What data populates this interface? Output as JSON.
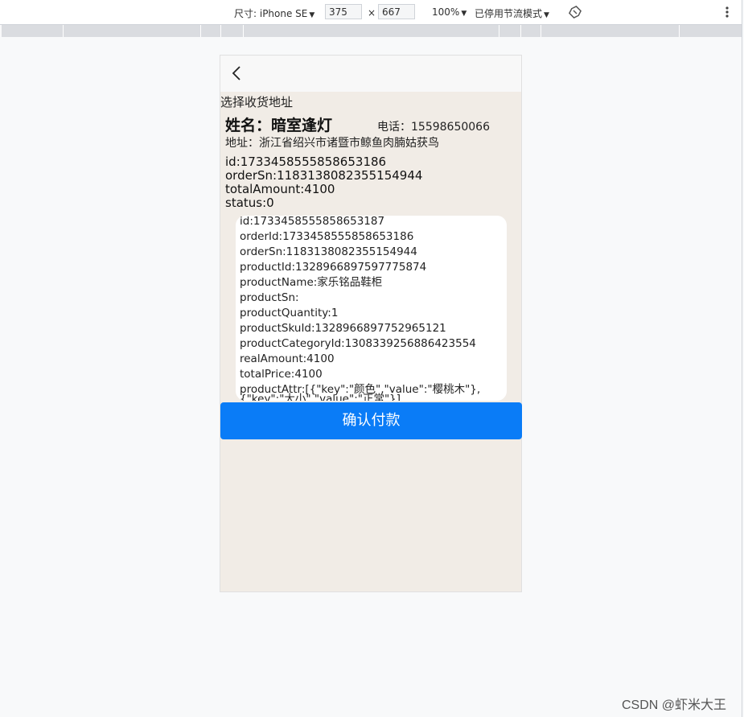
{
  "devtools": {
    "size_label": "尺寸: iPhone SE",
    "width": "375",
    "height": "667",
    "times": "×",
    "zoom": "100%",
    "throttle": "已停用节流模式"
  },
  "page": {
    "title": "选择收货地址",
    "address": {
      "name": "姓名：暗室逢灯",
      "phone": "电话：15598650066",
      "address": "地址：浙江省绍兴市诸暨市鲸鱼肉腩姑获鸟"
    },
    "order": [
      "id:1733458555858653186",
      "orderSn:1183138082355154944",
      "totalAmount:4100",
      "status:0"
    ],
    "item": {
      "fields": [
        "id:1733458555858653187",
        "orderId:1733458555858653186",
        "orderSn:1183138082355154944",
        "productId:1328966897597775874",
        "productName:家乐铭品鞋柜",
        "productSn:",
        "productQuantity:1",
        "productSkuId:1328966897752965121",
        "productCategoryId:1308339256886423554",
        "realAmount:4100",
        "totalPrice:4100"
      ],
      "attr": "productAttr:[{\"key\":\"颜色\",\"value\":\"樱桃木\"},{\"key\":\"大小\",\"value\":\"正常\"}]"
    },
    "pay_button": "确认付款"
  },
  "watermark": "CSDN @虾米大王",
  "colors": {
    "primary": "#0a7cf7",
    "page_bg": "#f1ece6"
  }
}
